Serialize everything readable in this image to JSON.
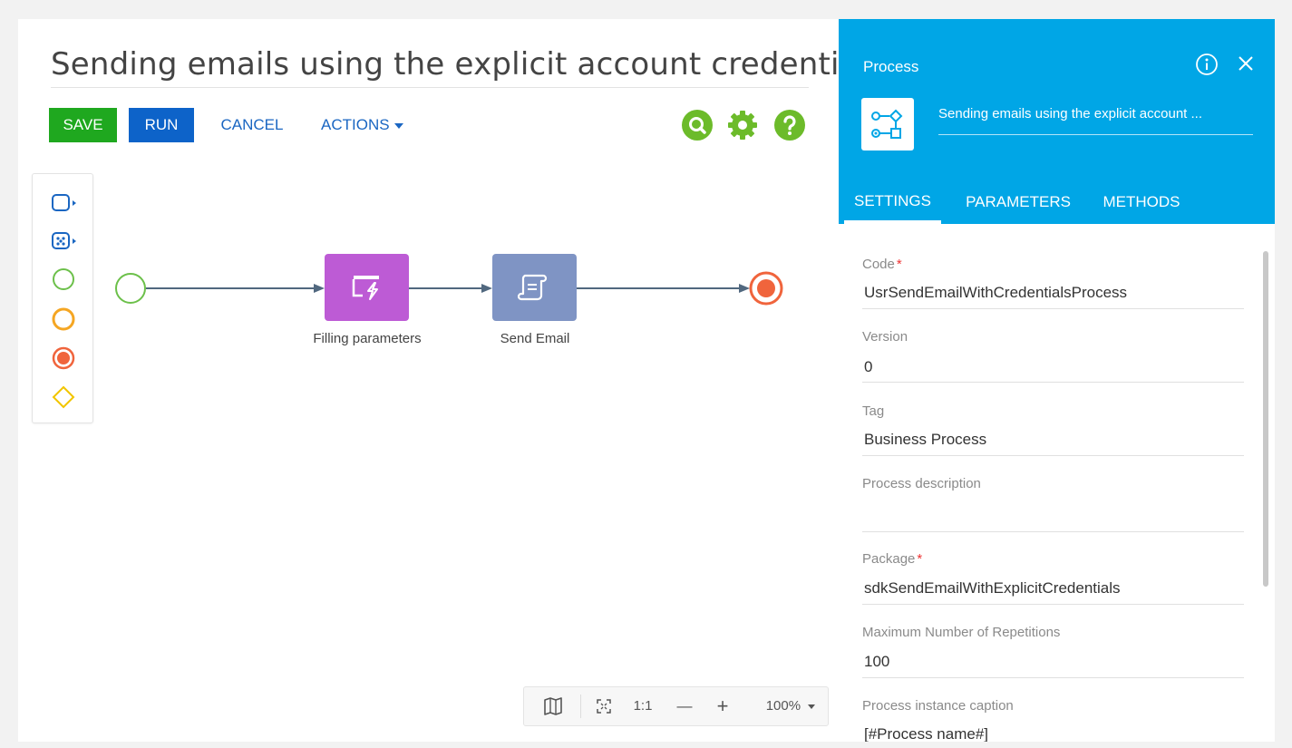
{
  "designer": {
    "title": "Sending emails using the explicit account credentials",
    "toolbar": {
      "save_label": "SAVE",
      "run_label": "RUN",
      "cancel_label": "CANCEL",
      "actions_label": "ACTIONS"
    },
    "toolbar_icons": [
      "search-icon",
      "gear-icon",
      "help-icon"
    ],
    "palette": [
      "task-icon",
      "subprocess-icon",
      "start-event-icon",
      "intermediate-event-icon",
      "end-event-icon",
      "gateway-icon"
    ],
    "elements": [
      {
        "label": "Filling parameters",
        "type": "formula-task",
        "color": "#bd5bd5"
      },
      {
        "label": "Send Email",
        "type": "script-task",
        "color": "#7f94c4"
      }
    ],
    "zoom": {
      "map_icon": "map-icon",
      "fit_icon": "fit-screen-icon",
      "actual_size_label": "1:1",
      "zoom_out_label": "—",
      "zoom_in_label": "+",
      "zoom_level": "100%"
    }
  },
  "panel": {
    "title": "Process",
    "process_name": "Sending emails using the explicit account ...",
    "tabs": [
      {
        "label": "SETTINGS",
        "active": true
      },
      {
        "label": "PARAMETERS",
        "active": false
      },
      {
        "label": "METHODS",
        "active": false
      }
    ],
    "fields": [
      {
        "label": "Code",
        "required": true,
        "value": "UsrSendEmailWithCredentialsProcess"
      },
      {
        "label": "Version",
        "required": false,
        "value": "0"
      },
      {
        "label": "Tag",
        "required": false,
        "value": "Business Process"
      },
      {
        "label": "Process description",
        "required": false,
        "value": ""
      },
      {
        "label": "Package",
        "required": true,
        "value": "sdkSendEmailWithExplicitCredentials"
      },
      {
        "label": "Maximum Number of Repetitions",
        "required": false,
        "value": "100"
      },
      {
        "label": "Process instance caption",
        "required": false,
        "value": "[#Process name#]"
      }
    ],
    "required_mark": "*"
  },
  "colors": {
    "save": "#1fa81f",
    "run": "#0d63c9",
    "link": "#1a66c2",
    "panel_header": "#00a6e6",
    "icon_green": "#6cbb2a",
    "start_event": "#6cc04a",
    "end_event": "#f0643c",
    "intermediate_event": "#f5a623",
    "gateway": "#f2c500",
    "connector": "#51687f"
  }
}
